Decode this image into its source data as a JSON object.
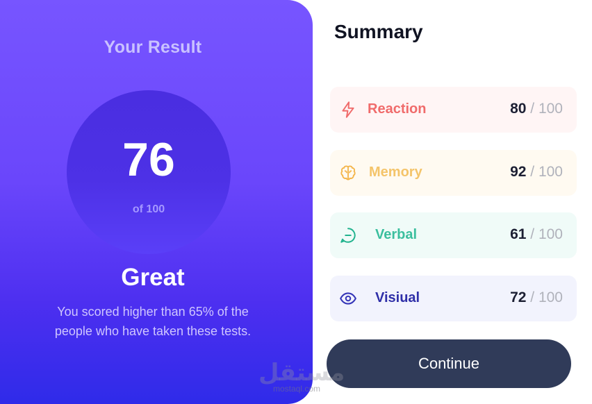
{
  "result": {
    "title": "Your Result",
    "score": "76",
    "of_label": "of 100",
    "grade": "Great",
    "description": "You scored higher than 65% of the people who have taken these tests."
  },
  "summary": {
    "title": "Summary",
    "items": [
      {
        "label": "Reaction",
        "score": "80",
        "max": "/ 100",
        "icon": "lightning-icon",
        "color": "#f06b6b"
      },
      {
        "label": "Memory",
        "score": "92",
        "max": "/ 100",
        "icon": "brain-icon",
        "color": "#f4c46a"
      },
      {
        "label": "Verbal",
        "score": "61",
        "max": "/ 100",
        "icon": "chat-bubble-icon",
        "color": "#3bbf9e"
      },
      {
        "label": "Visiual",
        "score": "72",
        "max": "/ 100",
        "icon": "eye-icon",
        "color": "#2f2fa8"
      }
    ],
    "continue_label": "Continue"
  },
  "watermark": {
    "arabic": "مستقل",
    "latin": "mostaql.com"
  },
  "colors": {
    "panel_gradient_top": "#7755ff",
    "panel_gradient_bottom": "#2f2be9",
    "button_bg": "#303b59"
  }
}
